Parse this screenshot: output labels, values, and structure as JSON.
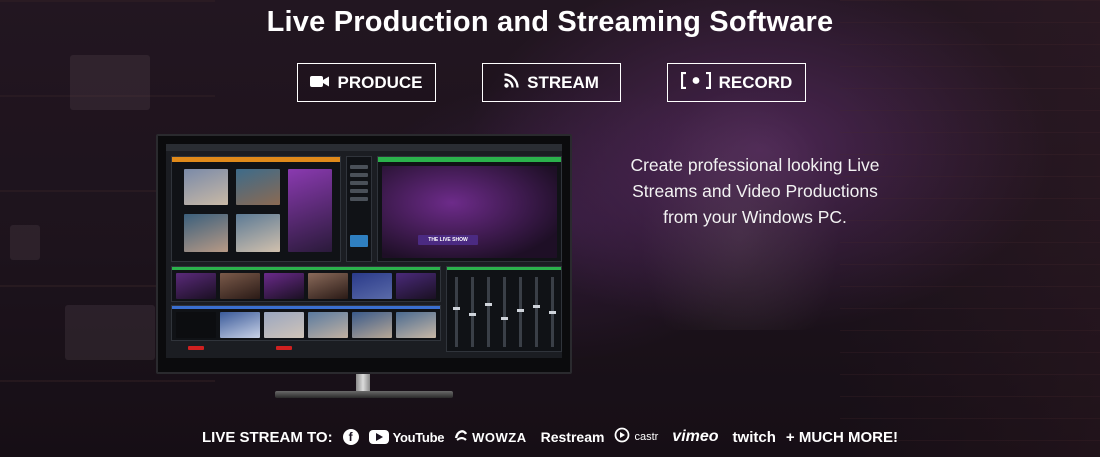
{
  "hero": {
    "title": "Live Production and Streaming Software",
    "tagline_lines": [
      "Create professional looking Live",
      "Streams and Video Productions",
      "from your Windows PC."
    ]
  },
  "buttons": [
    {
      "label": "PRODUCE",
      "icon": "video-camera-icon"
    },
    {
      "label": "STREAM",
      "icon": "rss-icon"
    },
    {
      "label": "RECORD",
      "icon": "record-icon"
    }
  ],
  "monitor": {
    "preview_overlay": "THE LIVE SHOW"
  },
  "streambar": {
    "lead": "LIVE STREAM TO:",
    "platforms": [
      {
        "name": "Facebook",
        "icon": "facebook-icon"
      },
      {
        "name": "YouTube",
        "icon": "youtube-icon"
      },
      {
        "name": "WOWZA",
        "icon": "wowza-icon"
      },
      {
        "name": "Restream",
        "icon": "restream-icon"
      },
      {
        "name": "castr",
        "icon": "castr-icon"
      },
      {
        "name": "vimeo",
        "icon": "vimeo-icon"
      },
      {
        "name": "twitch",
        "icon": "twitch-icon"
      }
    ],
    "tail": "+ MUCH MORE!"
  },
  "colors": {
    "accent_purple": "#9646aa",
    "text": "#ffffff",
    "record_red": "#d02020",
    "live_green": "#2bb24c"
  }
}
